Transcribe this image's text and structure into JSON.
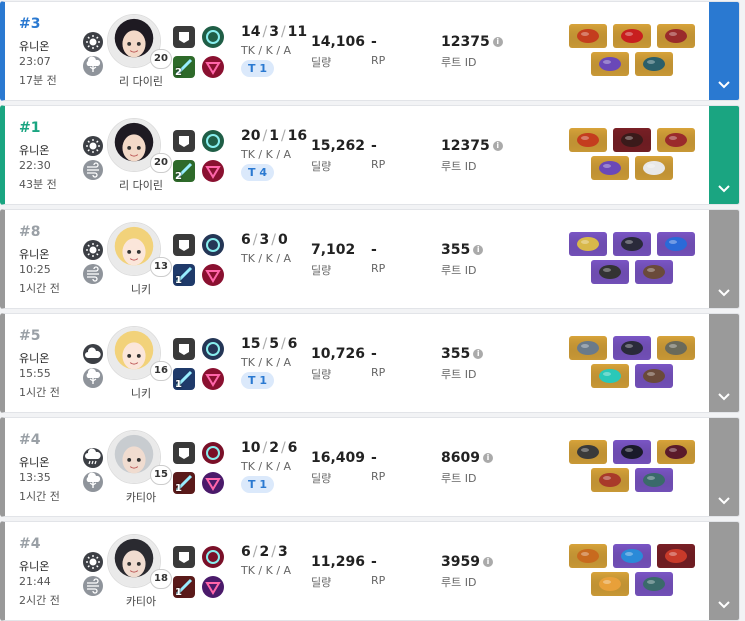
{
  "colors": {
    "top": "#2a79d1",
    "win": "#1aa581",
    "lose": "#9a9a9a"
  },
  "matches": [
    {
      "result": "top",
      "rank": "#3",
      "mode": "유니온",
      "time": "23:07",
      "ago": "17분 전",
      "weather1_icon": "sun-icon",
      "weather2_icon": "sprout-icon",
      "level": "20",
      "character": "리 다이린",
      "portrait_hair": "#1e1a22",
      "portrait_skin": "#f3d9c8",
      "skill_counts": [
        "",
        "",
        "2",
        ""
      ],
      "skill_colors": [
        "#3a3a3a",
        "#1f5e46",
        "#2e6a2a",
        "#8a1030"
      ],
      "k": "14",
      "d": "3",
      "a": "11",
      "kda_label": "TK / K / A",
      "tier": "T 1",
      "damage": "14,106",
      "damage_label": "딜량",
      "rp": "-",
      "rp_label": "RP",
      "route_id": "12375",
      "route_label": "루트 ID",
      "item_colors": [
        "#d8a43a",
        "#d8a43a",
        "#d8a43a",
        "#d8a43a",
        "#d8a43a"
      ],
      "item_accents": [
        "#c43d1e",
        "#c81f1f",
        "#9a2b2b",
        "#6a48b8",
        "#2b5f6a"
      ]
    },
    {
      "result": "win",
      "rank": "#1",
      "mode": "유니온",
      "time": "22:30",
      "ago": "43분 전",
      "weather1_icon": "sun-icon",
      "weather2_icon": "wind-icon",
      "level": "20",
      "character": "리 다이린",
      "portrait_hair": "#1e1a22",
      "portrait_skin": "#f3d9c8",
      "skill_counts": [
        "",
        "",
        "2",
        ""
      ],
      "skill_colors": [
        "#3a3a3a",
        "#1f5e46",
        "#2e6a2a",
        "#8a1030"
      ],
      "k": "20",
      "d": "1",
      "a": "16",
      "kda_label": "TK / K / A",
      "tier": "T 4",
      "damage": "15,262",
      "damage_label": "딜량",
      "rp": "-",
      "rp_label": "RP",
      "route_id": "12375",
      "route_label": "루트 ID",
      "item_colors": [
        "#d8a43a",
        "#7a2026",
        "#d8a43a",
        "#d8a43a",
        "#d8a43a"
      ],
      "item_accents": [
        "#c43d1e",
        "#3a1a1a",
        "#9a2b2b",
        "#6a48b8",
        "#e8e8e8"
      ]
    },
    {
      "result": "lose",
      "rank": "#8",
      "mode": "유니온",
      "time": "10:25",
      "ago": "1시간 전",
      "weather1_icon": "sun-icon",
      "weather2_icon": "wind-icon",
      "level": "13",
      "character": "니키",
      "portrait_hair": "#f2d27a",
      "portrait_skin": "#fbe6da",
      "skill_counts": [
        "",
        "",
        "1",
        ""
      ],
      "skill_colors": [
        "#3a3a3a",
        "#243656",
        "#1f3a6a",
        "#8a1030"
      ],
      "k": "6",
      "d": "3",
      "a": "0",
      "kda_label": "TK / K / A",
      "tier": "",
      "damage": "7,102",
      "damage_label": "딜량",
      "rp": "-",
      "rp_label": "RP",
      "route_id": "355",
      "route_label": "루트 ID",
      "item_colors": [
        "#7b56c6",
        "#7b56c6",
        "#7b56c6",
        "#7b56c6",
        "#7b56c6"
      ],
      "item_accents": [
        "#d8b84a",
        "#2a2a3a",
        "#2a6ad8",
        "#333",
        "#6a4a3a"
      ]
    },
    {
      "result": "lose",
      "rank": "#5",
      "mode": "유니온",
      "time": "15:55",
      "ago": "1시간 전",
      "weather1_icon": "cloud-icon",
      "weather2_icon": "sprout-icon",
      "level": "16",
      "character": "니키",
      "portrait_hair": "#f2d27a",
      "portrait_skin": "#fbe6da",
      "skill_counts": [
        "",
        "",
        "1",
        ""
      ],
      "skill_colors": [
        "#3a3a3a",
        "#243656",
        "#1f3a6a",
        "#8a1030"
      ],
      "k": "15",
      "d": "5",
      "a": "6",
      "kda_label": "TK / K / A",
      "tier": "T 1",
      "damage": "10,726",
      "damage_label": "딜량",
      "rp": "-",
      "rp_label": "RP",
      "route_id": "355",
      "route_label": "루트 ID",
      "item_colors": [
        "#d8a43a",
        "#7b56c6",
        "#d8a43a",
        "#d8a43a",
        "#7b56c6"
      ],
      "item_accents": [
        "#6a7a8a",
        "#2a2a3a",
        "#6a6a5a",
        "#2ac8b8",
        "#6a4a3a"
      ]
    },
    {
      "result": "lose",
      "rank": "#4",
      "mode": "유니온",
      "time": "13:35",
      "ago": "1시간 전",
      "weather1_icon": "rain-icon",
      "weather2_icon": "sprout-icon",
      "level": "15",
      "character": "카티아",
      "portrait_hair": "#c8ccd0",
      "portrait_skin": "#f0dcd0",
      "skill_counts": [
        "",
        "",
        "1",
        ""
      ],
      "skill_colors": [
        "#3a3a3a",
        "#7a1028",
        "#5a1a1a",
        "#4a1a6a"
      ],
      "k": "10",
      "d": "2",
      "a": "6",
      "kda_label": "TK / K / A",
      "tier": "T 1",
      "damage": "16,409",
      "damage_label": "딜량",
      "rp": "-",
      "rp_label": "RP",
      "route_id": "8609",
      "route_label": "루트 ID",
      "item_colors": [
        "#d8a43a",
        "#7b56c6",
        "#d8a43a",
        "#d8a43a",
        "#7b56c6"
      ],
      "item_accents": [
        "#3a3a3a",
        "#1a1a2a",
        "#5a1a2a",
        "#a83a2a",
        "#3a6a6a"
      ]
    },
    {
      "result": "lose",
      "rank": "#4",
      "mode": "유니온",
      "time": "21:44",
      "ago": "2시간 전",
      "weather1_icon": "sun-icon",
      "weather2_icon": "wind-icon",
      "level": "18",
      "character": "카티아",
      "portrait_hair": "#2a2a30",
      "portrait_skin": "#f0dcd0",
      "skill_counts": [
        "",
        "",
        "1",
        ""
      ],
      "skill_colors": [
        "#3a3a3a",
        "#7a1028",
        "#5a1a1a",
        "#4a1a6a"
      ],
      "k": "6",
      "d": "2",
      "a": "3",
      "kda_label": "TK / K / A",
      "tier": "",
      "damage": "11,296",
      "damage_label": "딜량",
      "rp": "-",
      "rp_label": "RP",
      "route_id": "3959",
      "route_label": "루트 ID",
      "item_colors": [
        "#d8a43a",
        "#7b56c6",
        "#7a2026",
        "#d8a43a",
        "#7b56c6"
      ],
      "item_accents": [
        "#c86a1e",
        "#2a8ad8",
        "#c83a2a",
        "#e8a03a",
        "#3a6a6a"
      ]
    }
  ]
}
